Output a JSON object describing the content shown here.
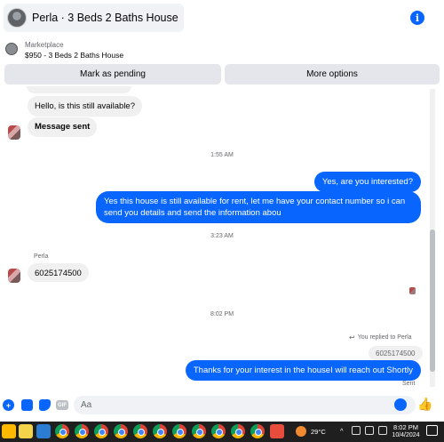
{
  "header": {
    "title": "Perla · 3 Beds 2 Baths House",
    "info_icon_glyph": "i"
  },
  "marketplace": {
    "label": "Marketplace",
    "listing": "$950 - 3 Beds 2 Baths House",
    "buttons": {
      "pending": "Mark as pending",
      "more": "More options"
    }
  },
  "chat": {
    "messages": [
      {
        "side": "left",
        "text": "Hello, is this still available?"
      },
      {
        "side": "left",
        "text": "Message sent",
        "bold": true
      },
      {
        "time": "1:55 AM"
      },
      {
        "side": "right",
        "text": "Yes, are you interested?"
      },
      {
        "side": "right",
        "text": "Yes this house is still available for rent, let me have your contact number so i can send you details and send the information abou"
      },
      {
        "time": "3:23 AM"
      },
      {
        "sender": "Perla"
      },
      {
        "side": "left",
        "text": "6025174500"
      },
      {
        "time": "8:02 PM"
      },
      {
        "replied": "You replied to Perla"
      },
      {
        "quoted": "6025174500"
      },
      {
        "side": "right",
        "text": "Thanks for your interest in the houseI will reach out Shortly"
      },
      {
        "status": "Sent"
      }
    ]
  },
  "composer": {
    "placeholder": "Aa",
    "gif_label": "GIF"
  },
  "taskbar": {
    "weather": "29°C",
    "time": "8:02 PM",
    "date": "10/4/2024"
  },
  "colors": {
    "accent": "#0866ff",
    "bubble_gray": "#f0f0f0",
    "taskbar": "#1f1f1f"
  },
  "icons": [
    "info-icon",
    "plus-icon",
    "image-icon",
    "sticker-icon",
    "gif-icon",
    "emoji-icon",
    "like-icon",
    "chrome-icon",
    "windows-icon"
  ]
}
